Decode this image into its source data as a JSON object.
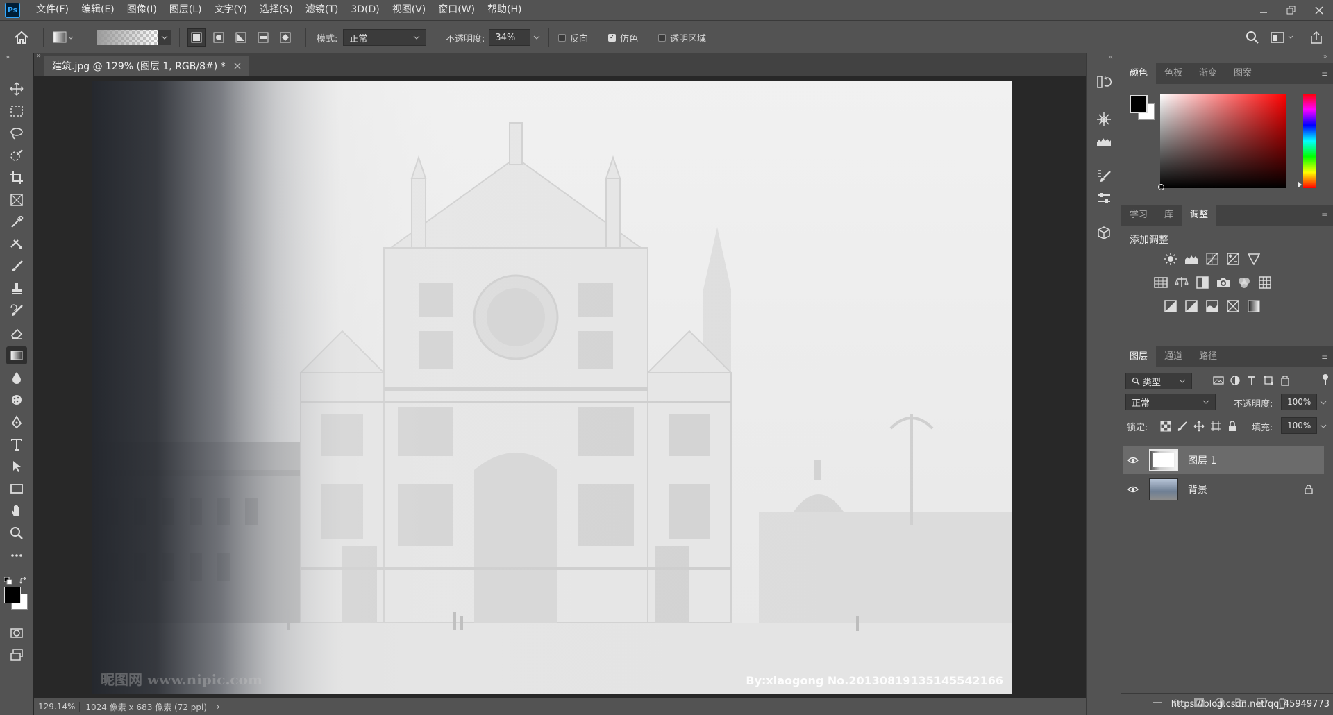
{
  "app": {
    "logo": "Ps"
  },
  "menu": [
    "文件(F)",
    "编辑(E)",
    "图像(I)",
    "图层(L)",
    "文字(Y)",
    "选择(S)",
    "滤镜(T)",
    "3D(D)",
    "视图(V)",
    "窗口(W)",
    "帮助(H)"
  ],
  "options": {
    "mode_label": "模式:",
    "mode_value": "正常",
    "opacity_label": "不透明度:",
    "opacity_value": "34%",
    "reverse_label": "反向",
    "dither_label": "仿色",
    "transparency_label": "透明区域",
    "reverse_checked": false,
    "dither_checked": true,
    "transparency_checked": false
  },
  "document": {
    "tab_title": "建筑.jpg @ 129% (图层 1, RGB/8#) *",
    "watermark_left": "昵图网 www.nipic.com",
    "watermark_right": "By:xiaogong No.20130819135145542166"
  },
  "status": {
    "zoom": "129.14%",
    "doc_info": "1024 像素 x 683 像素 (72 ppi)",
    "arrow": "›"
  },
  "color_panel": {
    "tabs": [
      "颜色",
      "色板",
      "渐变",
      "图案"
    ],
    "active_tab": 0,
    "foreground": "#000000",
    "background": "#ffffff",
    "hue_base": "#ff0000"
  },
  "adjust_panel": {
    "tabs": [
      "学习",
      "库",
      "调整"
    ],
    "active_tab": 2,
    "title": "添加调整"
  },
  "layers_panel": {
    "tabs": [
      "图层",
      "通道",
      "路径"
    ],
    "active_tab": 0,
    "filter_label": "类型",
    "blend_mode": "正常",
    "opacity_label": "不透明度:",
    "opacity_value": "100%",
    "lock_label": "锁定:",
    "fill_label": "填充:",
    "fill_value": "100%",
    "layers": [
      {
        "name": "图层 1",
        "selected": true,
        "locked": false
      },
      {
        "name": "背景",
        "selected": false,
        "locked": true
      }
    ]
  },
  "footer_url": "https://blog.csdn.net/qq_45949773"
}
